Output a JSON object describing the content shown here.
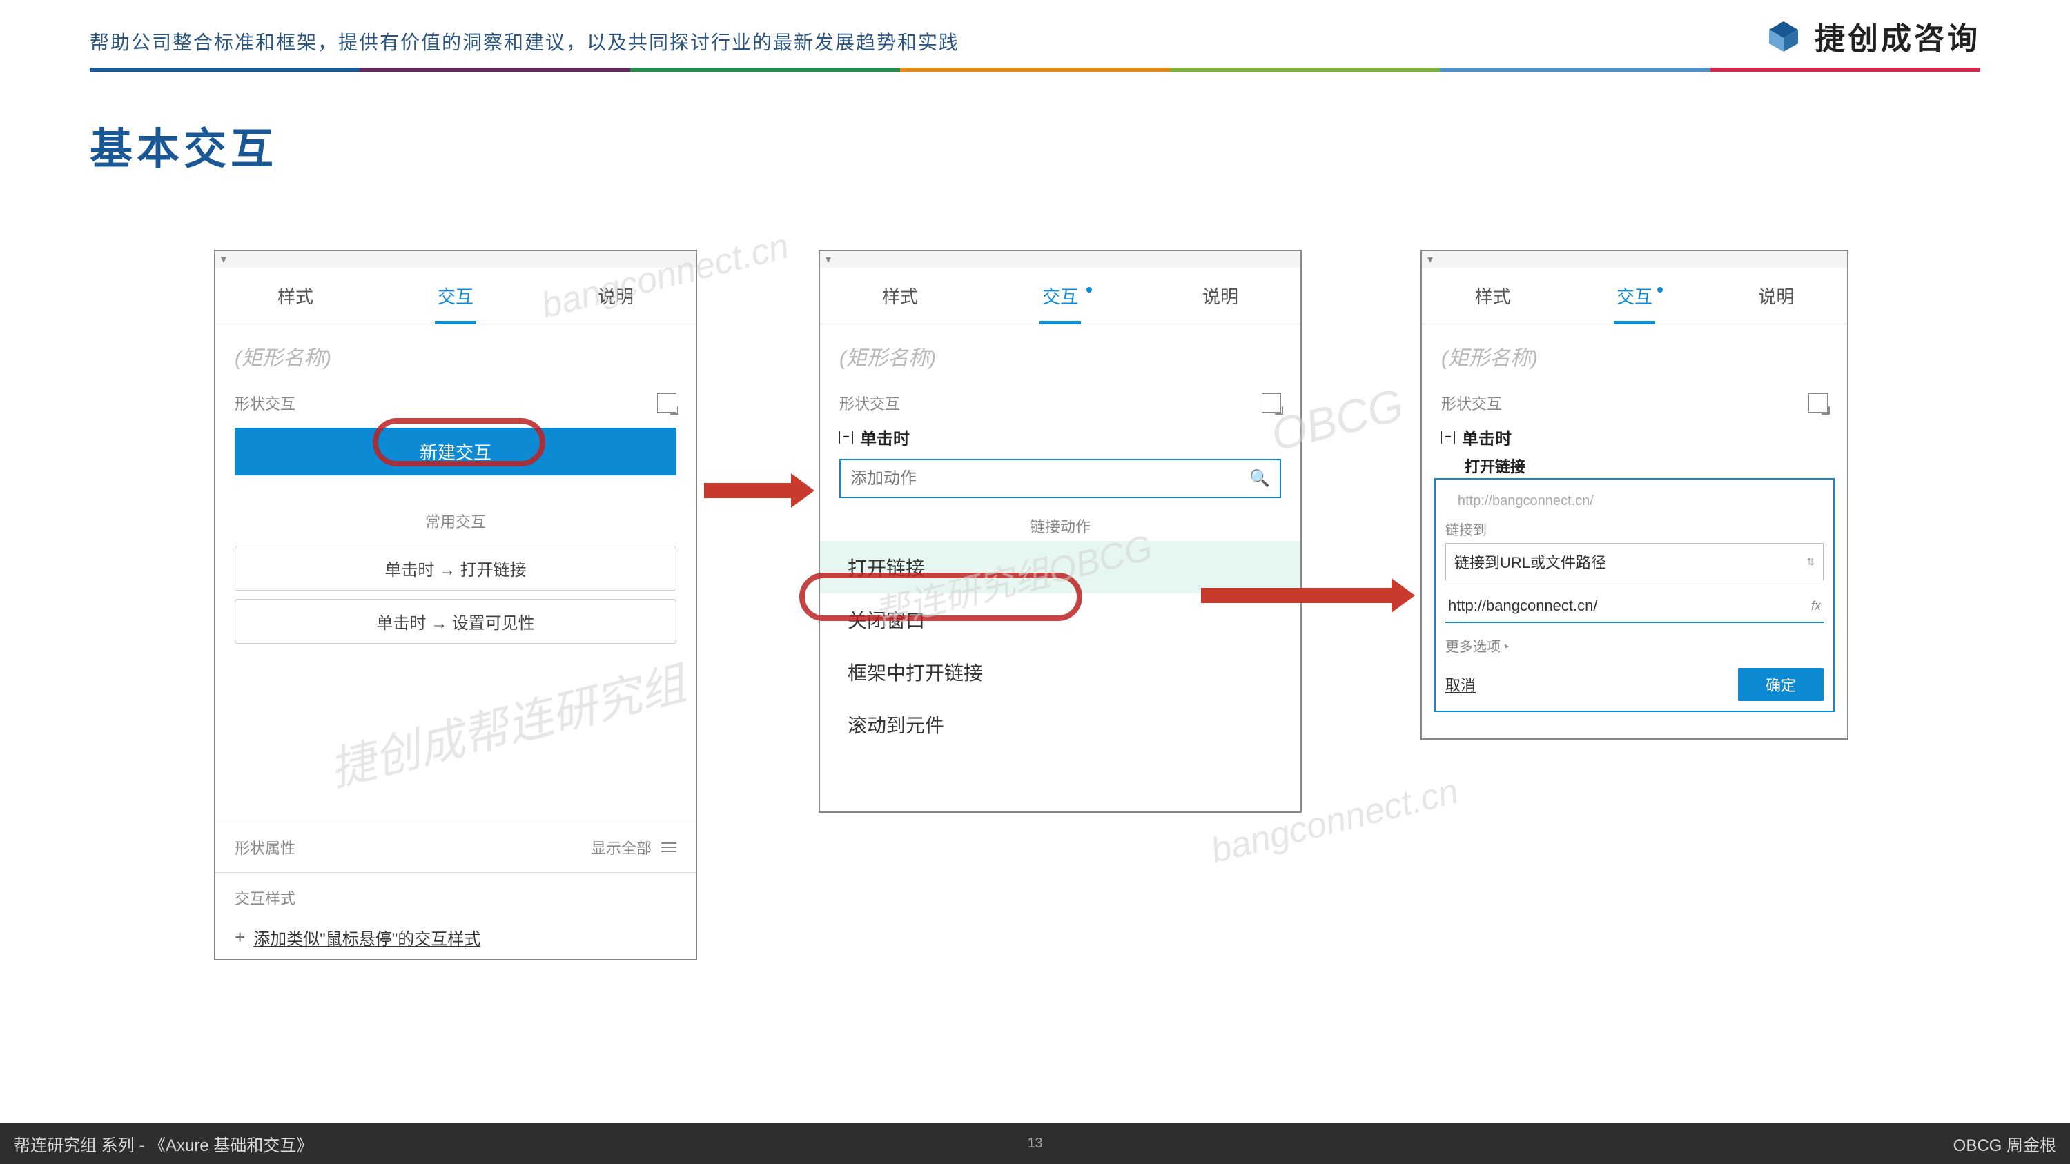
{
  "header": {
    "tagline": "帮助公司整合标准和框架，提供有价值的洞察和建议，以及共同探讨行业的最新发展趋势和实践"
  },
  "brand": {
    "name": "捷创成咨询"
  },
  "slide": {
    "title": "基本交互"
  },
  "tabs": {
    "style": "样式",
    "interact": "交互",
    "notes": "说明"
  },
  "panel1": {
    "placeholder": "(矩形名称)",
    "shape_interact": "形状交互",
    "new_interact": "新建交互",
    "common_interact": "常用交互",
    "btn1": "单击时 → 打开链接",
    "btn2": "单击时 → 设置可见性",
    "shape_props": "形状属性",
    "show_all": "显示全部",
    "style_section": "交互样式",
    "add_style": "添加类似\"鼠标悬停\"的交互样式"
  },
  "panel2": {
    "placeholder": "(矩形名称)",
    "shape_interact": "形状交互",
    "on_click": "单击时",
    "add_action": "添加动作",
    "link_actions": "链接动作",
    "open_link": "打开链接",
    "close_window": "关闭窗口",
    "open_in_frame": "框架中打开链接",
    "scroll_to": "滚动到元件"
  },
  "panel3": {
    "placeholder": "(矩形名称)",
    "shape_interact": "形状交互",
    "on_click": "单击时",
    "open_link": "打开链接",
    "url_hint": "http://bangconnect.cn/",
    "link_to": "链接到",
    "link_select": "链接到URL或文件路径",
    "url_value": "http://bangconnect.cn/",
    "more": "更多选项",
    "cancel": "取消",
    "ok": "确定"
  },
  "watermarks": {
    "w1": "bangconnect.cn",
    "w2": "帮连研究组OBCG",
    "w3": "捷创成帮连研究组",
    "w4": "bangconnect.cn",
    "w5": "OBCG"
  },
  "footer": {
    "left": "帮连研究组 系列 - 《Axure 基础和交互》",
    "page": "13",
    "right": "OBCG 周金根"
  }
}
